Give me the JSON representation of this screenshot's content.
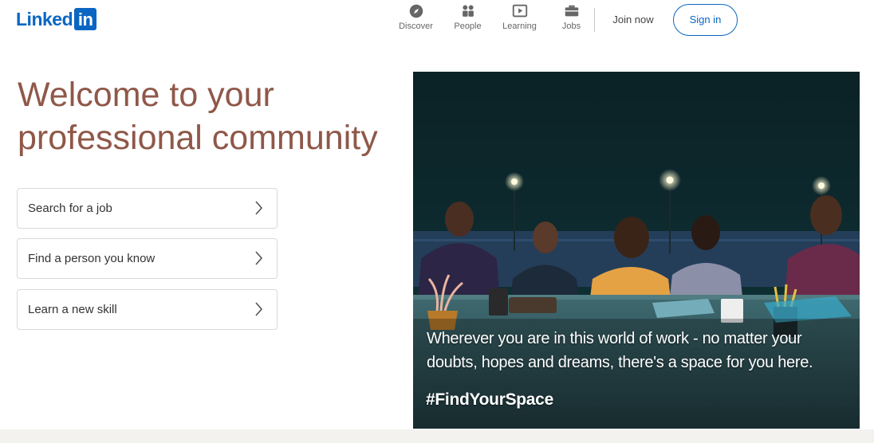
{
  "header": {
    "logo_text": "Linked",
    "logo_box": "in",
    "nav": [
      {
        "label": "Discover",
        "icon": "compass-icon"
      },
      {
        "label": "People",
        "icon": "people-icon"
      },
      {
        "label": "Learning",
        "icon": "play-icon"
      },
      {
        "label": "Jobs",
        "icon": "briefcase-icon"
      }
    ],
    "join_label": "Join now",
    "signin_label": "Sign in"
  },
  "hero": {
    "title_line1": "Welcome to your",
    "title_line2": "professional community",
    "options": [
      {
        "label": "Search for a job"
      },
      {
        "label": "Find a person you know"
      },
      {
        "label": "Learn a new skill"
      }
    ]
  },
  "image": {
    "caption_line1": "Wherever you are in this world of work - no matter your",
    "caption_line2": "doubts, hopes and dreams, there's a space for you here.",
    "hashtag": "#FindYourSpace"
  },
  "colors": {
    "brand": "#0a66c2",
    "title": "#8f5849",
    "nav_text": "#666666"
  }
}
